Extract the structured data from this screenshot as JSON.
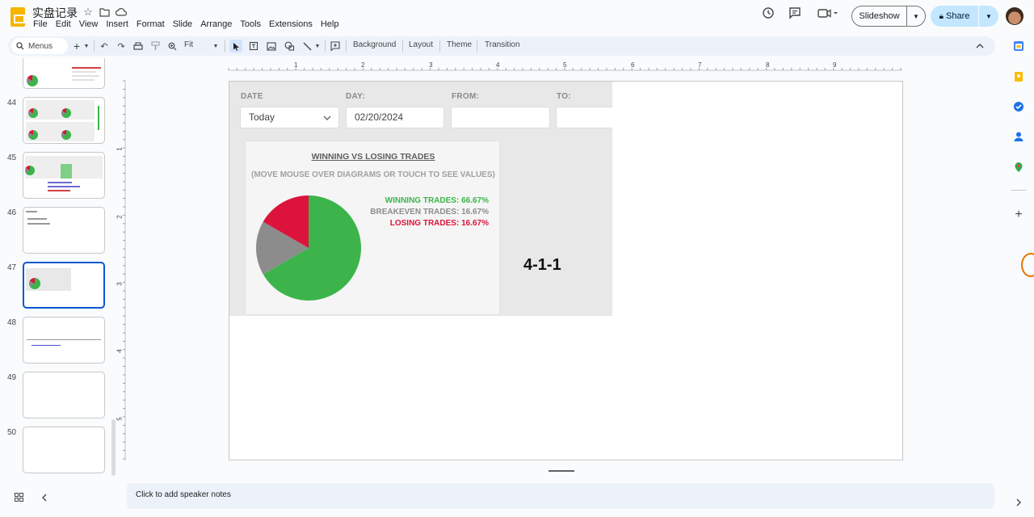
{
  "app": {
    "title": "实盘记录",
    "menus": [
      "File",
      "Edit",
      "View",
      "Insert",
      "Format",
      "Slide",
      "Arrange",
      "Tools",
      "Extensions",
      "Help"
    ],
    "slideshow_label": "Slideshow",
    "share_label": "Share"
  },
  "toolbar": {
    "search_label": "Menus",
    "zoom_label": "Fit",
    "background_label": "Background",
    "layout_label": "Layout",
    "theme_label": "Theme",
    "transition_label": "Transition"
  },
  "filmstrip": {
    "slides": [
      {
        "num": "",
        "selected": false
      },
      {
        "num": "44",
        "selected": false
      },
      {
        "num": "45",
        "selected": false
      },
      {
        "num": "46",
        "selected": false
      },
      {
        "num": "47",
        "selected": true
      },
      {
        "num": "48",
        "selected": false
      },
      {
        "num": "49",
        "selected": false
      },
      {
        "num": "50",
        "selected": false
      }
    ]
  },
  "rulers": {
    "horizontal": [
      "1",
      "2",
      "3",
      "4",
      "5",
      "6",
      "7",
      "8",
      "9"
    ],
    "vertical": [
      "1",
      "2",
      "3",
      "4",
      "5"
    ]
  },
  "slide": {
    "fields": [
      {
        "label": "DATE",
        "value": "Today",
        "type": "select"
      },
      {
        "label": "DAY:",
        "value": "02/20/2024",
        "type": "input"
      },
      {
        "label": "FROM:",
        "value": "",
        "type": "input"
      },
      {
        "label": "TO:",
        "value": "",
        "type": "input"
      }
    ],
    "panel_title": "WINNING VS LOSING TRADES",
    "panel_subtitle": "(MOVE MOUSE OVER DIAGRAMS OR TOUCH TO SEE VALUES)",
    "legend": [
      {
        "text": "WINNING TRADES: 66.67%",
        "color": "#3cb44b"
      },
      {
        "text": "BREAKEVEN TRADES: 16.67%",
        "color": "#8c8c8c"
      },
      {
        "text": "LOSING TRADES: 16.67%",
        "color": "#dc143c"
      }
    ],
    "pie": [
      {
        "value": 66.67,
        "color": "#3cb44b"
      },
      {
        "value": 16.67,
        "color": "#8c8c8c"
      },
      {
        "value": 16.67,
        "color": "#dc143c"
      }
    ],
    "big_label": "4-1-1"
  },
  "notes": {
    "placeholder": "Click to add speaker notes"
  },
  "colors": {
    "accent": "#0b57d0",
    "share_bg": "#c2e7ff",
    "toolbar_bg": "#edf2fa"
  }
}
